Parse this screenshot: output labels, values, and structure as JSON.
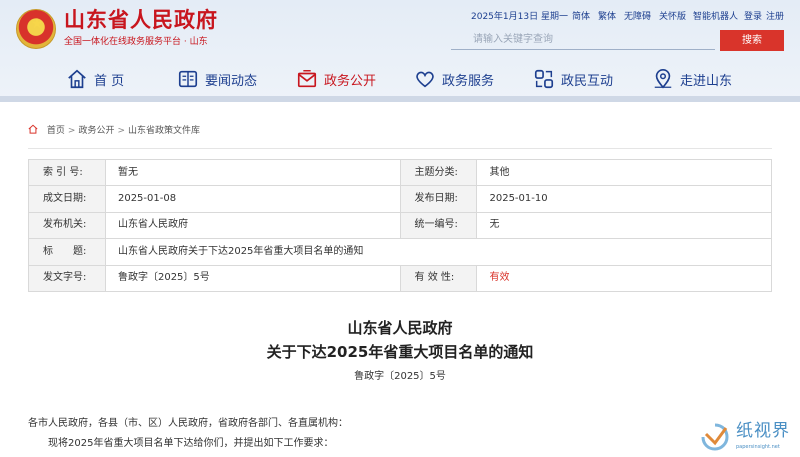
{
  "header": {
    "site_title": "山东省人民政府",
    "site_subtitle": "全国一体化在线政务服务平台 · 山东",
    "date": "2025年1月13日 星期一",
    "links": [
      "简体",
      "繁体",
      "无障碍",
      "关怀版",
      "智能机器人",
      "登录",
      "注册"
    ],
    "search_placeholder": "请输入关键字查询",
    "search_button": "搜索"
  },
  "nav": [
    {
      "label": "首 页",
      "icon": "home-icon"
    },
    {
      "label": "要闻动态",
      "icon": "news-icon"
    },
    {
      "label": "政务公开",
      "icon": "mail-icon",
      "active": true
    },
    {
      "label": "政务服务",
      "icon": "heart-icon"
    },
    {
      "label": "政民互动",
      "icon": "interaction-icon"
    },
    {
      "label": "走进山东",
      "icon": "map-pin-icon"
    }
  ],
  "breadcrumb": [
    "首页",
    "政务公开",
    "山东省政策文件库"
  ],
  "meta": {
    "index_label": "索 引 号:",
    "index_value": "暂无",
    "category_label": "主题分类:",
    "category_value": "其他",
    "created_label": "成文日期:",
    "created_value": "2025-01-08",
    "published_label": "发布日期:",
    "published_value": "2025-01-10",
    "issuer_label": "发布机关:",
    "issuer_value": "山东省人民政府",
    "unified_label": "统一编号:",
    "unified_value": "无",
    "title_label": "标　　题:",
    "title_value": "山东省人民政府关于下达2025年省重大项目名单的通知",
    "docno_label": "发文字号:",
    "docno_value": "鲁政字〔2025〕5号",
    "validity_label": "有 效 性:",
    "validity_value": "有效"
  },
  "document": {
    "title_line1": "山东省人民政府",
    "title_line2": "关于下达2025年省重大项目名单的通知",
    "doc_number": "鲁政字〔2025〕5号",
    "paragraph1": "各市人民政府，各县（市、区）人民政府，省政府各部门、各直属机构：",
    "paragraph2": "现将2025年省重大项目名单下达给你们，并提出如下工作要求："
  },
  "watermark": {
    "text": "纸视界",
    "url": "papersinsight.net"
  },
  "colors": {
    "brand_red": "#c8161e",
    "nav_blue": "#1d3f8f",
    "search_button": "#d9342b"
  }
}
